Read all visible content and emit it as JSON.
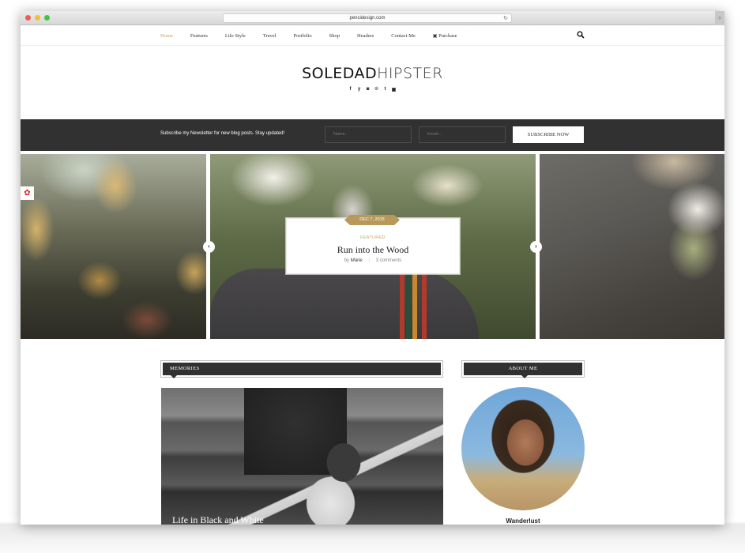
{
  "browser": {
    "url": "pencidesign.com",
    "reload_icon": "↻",
    "new_tab_icon": "+"
  },
  "nav": {
    "items": [
      {
        "label": "Home",
        "active": true
      },
      {
        "label": "Features"
      },
      {
        "label": "Life Style"
      },
      {
        "label": "Travel"
      },
      {
        "label": "Portfolio"
      },
      {
        "label": "Shop"
      },
      {
        "label": "Headers"
      },
      {
        "label": "Contact Me"
      },
      {
        "label": "Purchase",
        "icon": "cart-icon"
      }
    ],
    "cart_glyph": "🛒",
    "search_icon": "search-icon"
  },
  "logo": {
    "part1": "SOLEDAD",
    "part2": "HIPSTER"
  },
  "social": [
    {
      "name": "facebook-icon",
      "glyph": "f"
    },
    {
      "name": "twitter-icon",
      "glyph": "y"
    },
    {
      "name": "instagram-icon",
      "glyph": "◙"
    },
    {
      "name": "pinterest-icon",
      "glyph": "℗"
    },
    {
      "name": "tumblr-icon",
      "glyph": "t"
    },
    {
      "name": "youtube-icon",
      "glyph": "▣"
    }
  ],
  "newsletter": {
    "text": "Subscribe my Newsletter for new blog posts. Stay updated!",
    "name_placeholder": "Name...",
    "email_placeholder": "Email...",
    "button": "SUBSCRIBE NOW"
  },
  "slider": {
    "gear_glyph": "✿",
    "prev_glyph": "‹",
    "next_glyph": "›",
    "featured": {
      "date": "DEC 7, 2015",
      "category": "FEATURED",
      "title": "Run into the Wood",
      "by": "by",
      "author": "Marie",
      "separator": "|",
      "comments": "3 comments"
    }
  },
  "colors": {
    "accent_gold": "#c8a15d",
    "badge_gold": "#b8995a",
    "dark_bar": "#313131",
    "gear_red": "#e31b1b"
  },
  "memories": {
    "heading": "MEMORIES",
    "post_title": "Life in Black and White"
  },
  "about": {
    "heading": "ABOUT ME",
    "name": "Wanderlust"
  }
}
